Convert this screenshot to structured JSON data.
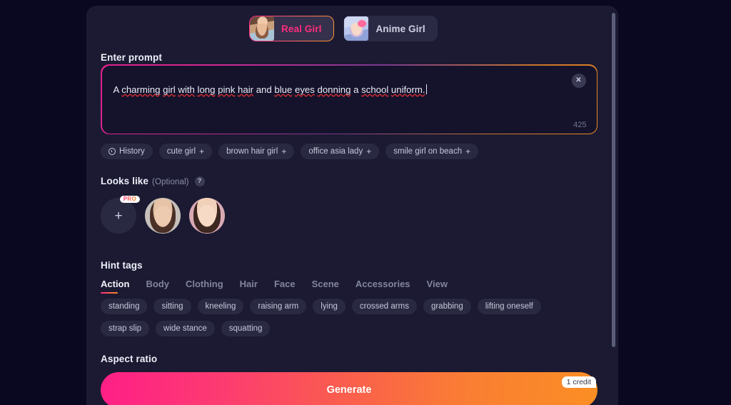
{
  "mode_tabs": [
    {
      "label": "Real Girl",
      "thumb": "real-girl-thumb",
      "active": true
    },
    {
      "label": "Anime Girl",
      "thumb": "anime-girl-thumb",
      "active": false
    }
  ],
  "prompt": {
    "section_label": "Enter prompt",
    "value": "A charming girl with long pink hair and blue eyes donning a school uniform.",
    "segments": [
      {
        "text": "A ",
        "spell": false
      },
      {
        "text": "charming",
        "spell": true
      },
      {
        "text": " ",
        "spell": false
      },
      {
        "text": "girl",
        "spell": true
      },
      {
        "text": " ",
        "spell": false
      },
      {
        "text": "with",
        "spell": true
      },
      {
        "text": " ",
        "spell": false
      },
      {
        "text": "long",
        "spell": true
      },
      {
        "text": " ",
        "spell": false
      },
      {
        "text": "pink",
        "spell": true
      },
      {
        "text": " ",
        "spell": false
      },
      {
        "text": "hair",
        "spell": true
      },
      {
        "text": " and ",
        "spell": false
      },
      {
        "text": "blue",
        "spell": true
      },
      {
        "text": " ",
        "spell": false
      },
      {
        "text": "eyes",
        "spell": true
      },
      {
        "text": " ",
        "spell": false
      },
      {
        "text": "donning",
        "spell": true
      },
      {
        "text": " a ",
        "spell": false
      },
      {
        "text": "school",
        "spell": true
      },
      {
        "text": " ",
        "spell": false
      },
      {
        "text": "uniform.",
        "spell": true
      }
    ],
    "char_count": "425",
    "clear_label": "✕"
  },
  "history_row": {
    "history_label": "History",
    "suggestions": [
      {
        "label": "cute girl",
        "plus": "+"
      },
      {
        "label": "brown hair girl",
        "plus": "+"
      },
      {
        "label": "office asia lady",
        "plus": "+"
      },
      {
        "label": "smile girl on beach",
        "plus": "+"
      }
    ]
  },
  "looks_like": {
    "label": "Looks like",
    "optional": "(Optional)",
    "help": "?",
    "add_label": "+",
    "pro_badge": "PRO",
    "avatars": [
      "add-photo",
      "face-thumb-1",
      "face-thumb-2"
    ]
  },
  "hint_tags": {
    "label": "Hint tags",
    "tabs": [
      {
        "label": "Action",
        "active": true
      },
      {
        "label": "Body",
        "active": false
      },
      {
        "label": "Clothing",
        "active": false
      },
      {
        "label": "Hair",
        "active": false
      },
      {
        "label": "Face",
        "active": false
      },
      {
        "label": "Scene",
        "active": false
      },
      {
        "label": "Accessories",
        "active": false
      },
      {
        "label": "View",
        "active": false
      }
    ],
    "tags": [
      "standing",
      "sitting",
      "kneeling",
      "raising arm",
      "lying",
      "crossed arms",
      "grabbing",
      "lifting oneself",
      "strap slip",
      "wide stance",
      "squatting"
    ]
  },
  "aspect_ratio": {
    "label": "Aspect ratio"
  },
  "generate": {
    "label": "Generate",
    "credit_badge": "1 credit"
  },
  "colors": {
    "page_bg": "#0a0820",
    "panel_bg": "#1b1a32",
    "prompt_bg": "#15132c",
    "accent_pink": "#ff2d7e",
    "accent_orange": "#fb8e24",
    "chip_bg": "#2a2942",
    "text_primary": "#eceef8",
    "text_muted": "#82859e"
  }
}
